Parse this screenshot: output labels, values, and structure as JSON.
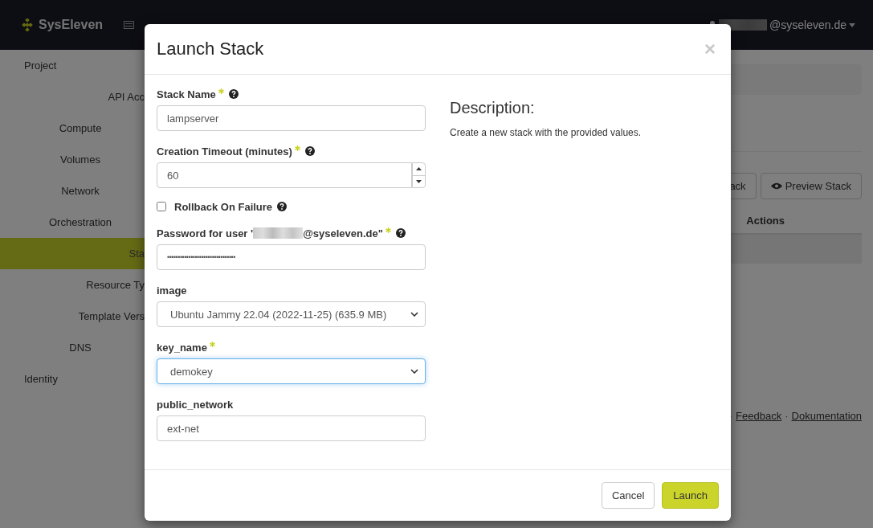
{
  "navbar": {
    "brand": "SysEleven",
    "user": {
      "redacted": true,
      "domain": "@syseleven.de"
    }
  },
  "sidebar": [
    {
      "label": "Project",
      "kind": "dashboard",
      "selected": false,
      "children": [
        {
          "label": "API Acc",
          "kind": "panel",
          "selected": false
        },
        {
          "label": "Compute",
          "kind": "group",
          "selected": false
        },
        {
          "label": "Volumes",
          "kind": "group",
          "selected": false
        },
        {
          "label": "Network",
          "kind": "group",
          "selected": false
        },
        {
          "label": "Orchestration",
          "kind": "group",
          "selected": false,
          "children": [
            {
              "label": "Sta",
              "kind": "panel",
              "selected": true
            },
            {
              "label": "Resource Ty",
              "kind": "panel",
              "selected": false
            },
            {
              "label": "Template Vers",
              "kind": "panel",
              "selected": false
            }
          ]
        },
        {
          "label": "DNS",
          "kind": "group",
          "selected": false
        }
      ]
    },
    {
      "label": "Identity",
      "kind": "dashboard",
      "selected": false
    }
  ],
  "content": {
    "toolbar": [
      {
        "label": "ack",
        "kind": "plain"
      },
      {
        "label": "Preview Stack",
        "kind": "eye"
      }
    ],
    "table_header": "Actions",
    "footer": [
      {
        "label": "·",
        "kind": "sep"
      },
      {
        "label": "Feedback",
        "kind": "link"
      },
      {
        "label": "·",
        "kind": "sep"
      },
      {
        "label": "Dokumentation",
        "kind": "link"
      }
    ]
  },
  "modal": {
    "title": "Launch Stack",
    "close": "×",
    "fields": [
      {
        "kind": "text",
        "label": "Stack Name",
        "required": true,
        "help": true,
        "value": "lampserver",
        "focused": false
      },
      {
        "kind": "number",
        "label": "Creation Timeout (minutes)",
        "required": true,
        "help": true,
        "value": "60",
        "focused": false
      },
      {
        "kind": "checkbox",
        "label": "Rollback On Failure",
        "required": false,
        "help": true,
        "checked": false
      },
      {
        "kind": "password",
        "label": "Password for user '",
        "label_suffix": "@syseleven.de\"",
        "redacted": true,
        "required": true,
        "help": true,
        "value": "••••••••••••••••••••••••••••••••",
        "focused": false
      },
      {
        "kind": "select",
        "label": "image",
        "required": false,
        "help": false,
        "value": "Ubuntu Jammy 22.04 (2022-11-25) (635.9 MB)",
        "focused": false
      },
      {
        "kind": "select",
        "label": "key_name",
        "required": true,
        "help": false,
        "value": "demokey",
        "focused": true
      },
      {
        "kind": "text",
        "label": "public_network",
        "required": false,
        "help": false,
        "value": "ext-net",
        "focused": false
      }
    ],
    "description_title": "Description:",
    "description": "Create a new stack with the provided values.",
    "buttons": [
      {
        "label": "Cancel",
        "kind": "default"
      },
      {
        "label": "Launch",
        "kind": "primary"
      }
    ]
  }
}
